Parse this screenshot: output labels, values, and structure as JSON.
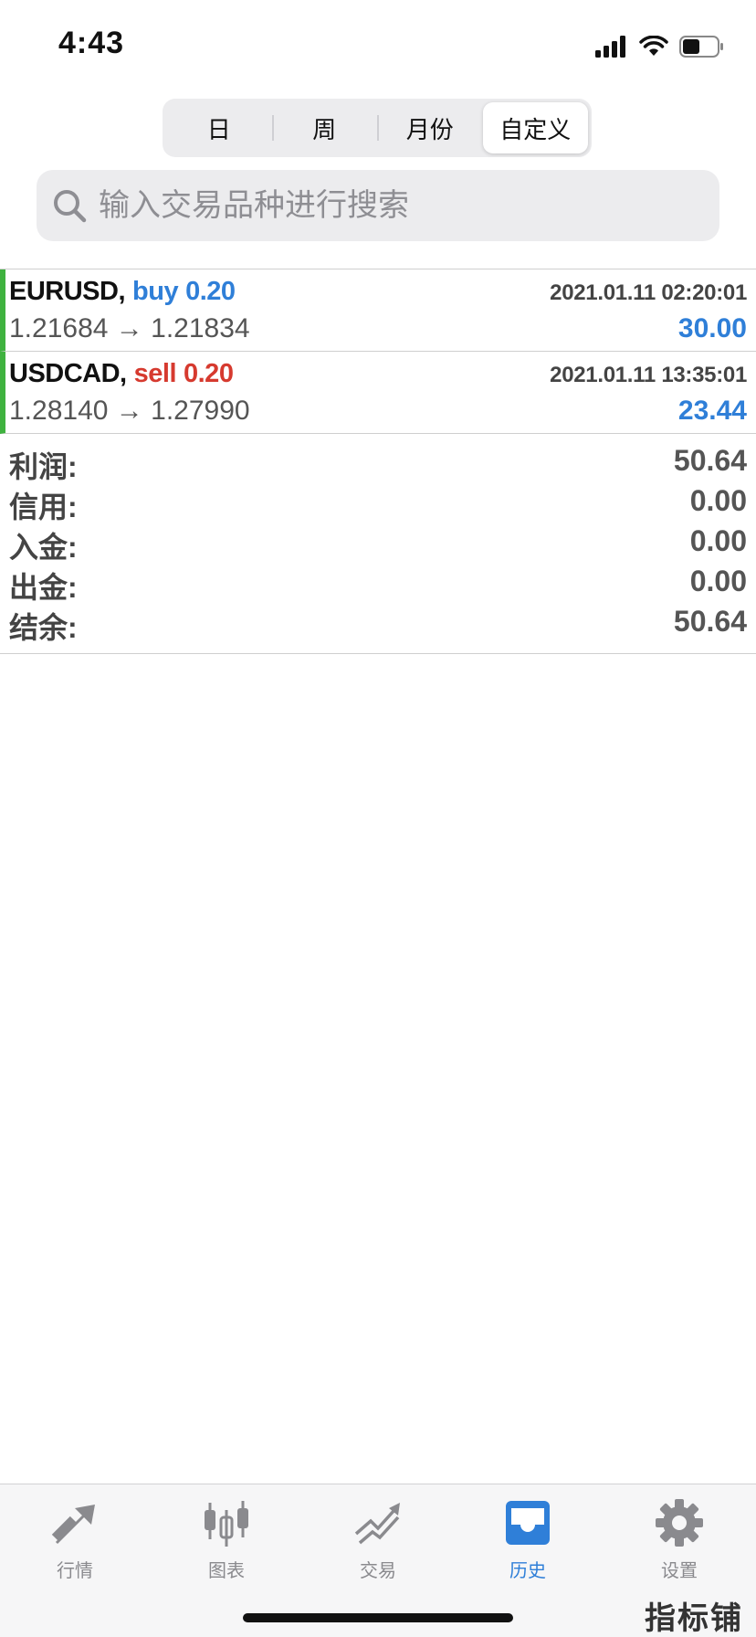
{
  "status_bar": {
    "time": "4:43"
  },
  "segmented": {
    "options": [
      "日",
      "周",
      "月份",
      "自定义"
    ],
    "selected": "自定义"
  },
  "search": {
    "placeholder": "输入交易品种进行搜索"
  },
  "trades": [
    {
      "symbol": "EURUSD,",
      "side": "buy",
      "volume": "0.20",
      "time": "2021.01.11 02:20:01",
      "open_price": "1.21684",
      "arrow": "→",
      "close_price": "1.21834",
      "profit": "30.00"
    },
    {
      "symbol": "USDCAD,",
      "side": "sell",
      "volume": "0.20",
      "time": "2021.01.11 13:35:01",
      "open_price": "1.28140",
      "arrow": "→",
      "close_price": "1.27990",
      "profit": "23.44"
    }
  ],
  "summary": {
    "profit_label": "利润:",
    "profit_value": "50.64",
    "credit_label": "信用:",
    "credit_value": "0.00",
    "deposit_label": "入金:",
    "deposit_value": "0.00",
    "withdrawal_label": "出金:",
    "withdrawal_value": "0.00",
    "balance_label": "结余:",
    "balance_value": "50.64"
  },
  "tabbar": {
    "tabs": [
      {
        "label": "行情",
        "icon": "quotes-icon"
      },
      {
        "label": "图表",
        "icon": "chart-candles-icon"
      },
      {
        "label": "交易",
        "icon": "trade-icon"
      },
      {
        "label": "历史",
        "icon": "history-inbox-icon"
      },
      {
        "label": "设置",
        "icon": "gear-icon"
      }
    ],
    "active": "历史"
  },
  "colors": {
    "buy": "#2f7fd8",
    "sell": "#d63a2f",
    "accent": "#2f7fd8",
    "trade_marker": "#3fb23f"
  },
  "watermark": "指标铺"
}
